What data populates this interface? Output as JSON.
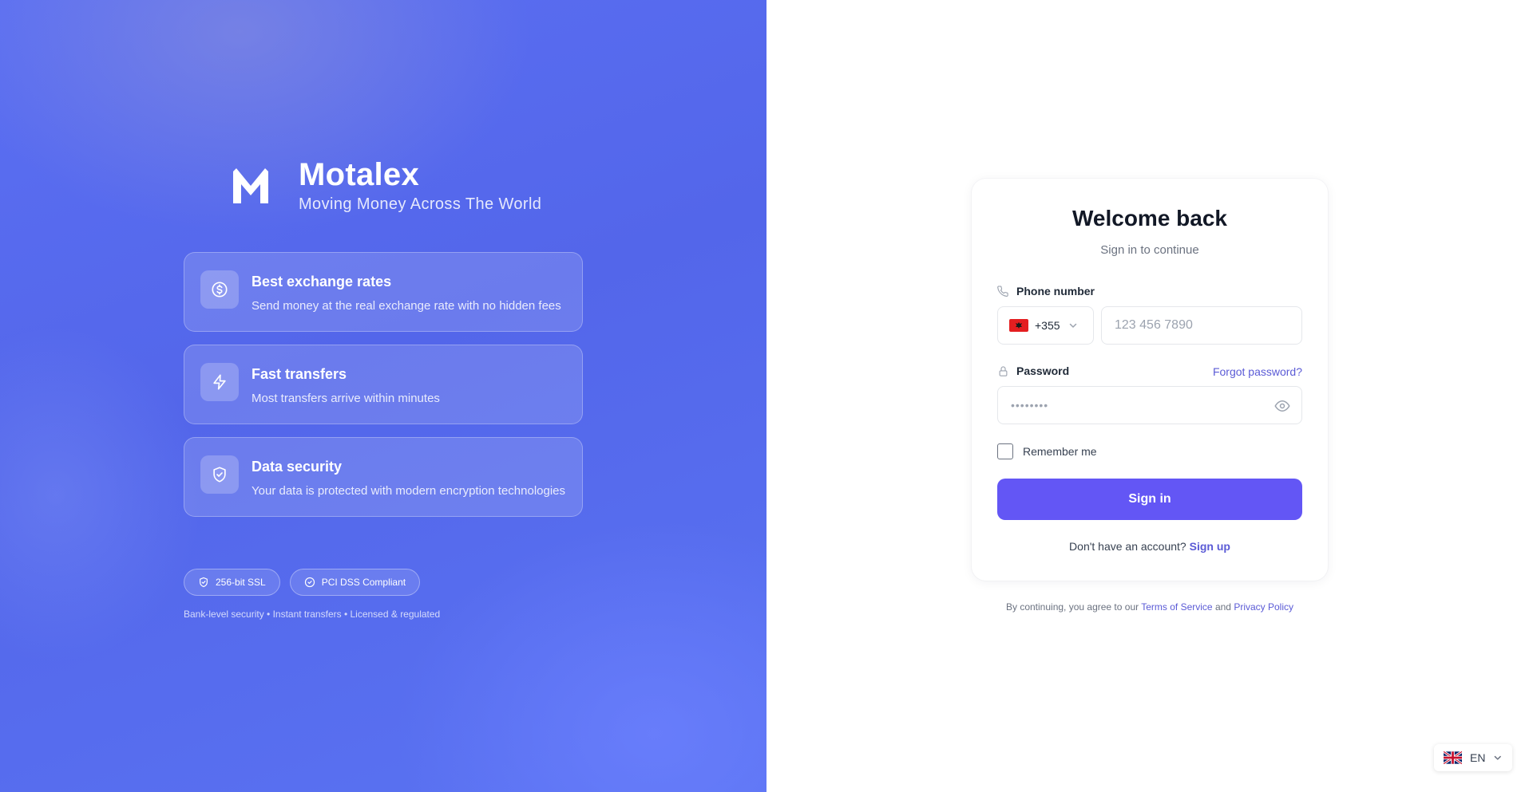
{
  "brand": {
    "name": "Motalex",
    "tagline": "Moving Money Across The World"
  },
  "features": [
    {
      "icon": "dollar-circle-icon",
      "title": "Best exchange rates",
      "description": "Send money at the real exchange rate with no hidden fees"
    },
    {
      "icon": "lightning-icon",
      "title": "Fast transfers",
      "description": "Most transfers arrive within minutes"
    },
    {
      "icon": "shield-check-icon",
      "title": "Data security",
      "description": "Your data is protected with modern encryption technologies"
    }
  ],
  "badges": [
    {
      "icon": "shield-icon",
      "label": "256-bit SSL"
    },
    {
      "icon": "check-circle-icon",
      "label": "PCI DSS Compliant"
    }
  ],
  "trust_line": "Bank-level security • Instant transfers • Licensed & regulated",
  "login": {
    "title": "Welcome back",
    "subtitle": "Sign in to continue",
    "phone_label": "Phone number",
    "country_code": "+355",
    "country_flag": "albania-flag",
    "phone_placeholder": "123 456 7890",
    "password_label": "Password",
    "forgot_label": "Forgot password?",
    "password_value": "••••••••",
    "remember_label": "Remember me",
    "signin_label": "Sign in",
    "signup_prompt": "Don't have an account?",
    "signup_link": "Sign up"
  },
  "legal": {
    "prefix": "By continuing, you agree to our",
    "terms": "Terms of Service",
    "and": "and",
    "privacy": "Privacy Policy"
  },
  "language": {
    "code": "EN",
    "flag": "uk-flag"
  },
  "colors": {
    "accent": "#6356f5",
    "link": "#5b5bd6",
    "left_panel": "#5366ea"
  }
}
